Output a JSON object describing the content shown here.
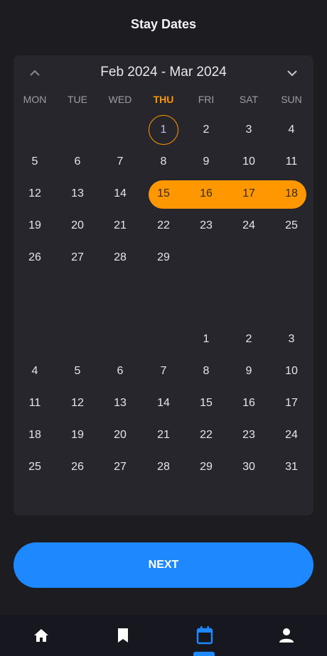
{
  "header": {
    "title": "Stay Dates"
  },
  "calendar": {
    "range_label": "Feb 2024 - Mar 2024",
    "weekdays": [
      "MON",
      "TUE",
      "WED",
      "THU",
      "FRI",
      "SAT",
      "SUN"
    ],
    "today_weekday": "THU",
    "months": [
      {
        "days": [
          [
            "",
            "",
            "",
            "1",
            "2",
            "3",
            "4"
          ],
          [
            "5",
            "6",
            "7",
            "8",
            "9",
            "10",
            "11"
          ],
          [
            "12",
            "13",
            "14",
            "15",
            "16",
            "17",
            "18"
          ],
          [
            "19",
            "20",
            "21",
            "22",
            "23",
            "24",
            "25"
          ],
          [
            "26",
            "27",
            "28",
            "29",
            "",
            "",
            ""
          ]
        ]
      },
      {
        "days": [
          [
            "",
            "",
            "",
            "",
            "1",
            "2",
            "3"
          ],
          [
            "4",
            "5",
            "6",
            "7",
            "8",
            "9",
            "10"
          ],
          [
            "11",
            "12",
            "13",
            "14",
            "15",
            "16",
            "17"
          ],
          [
            "18",
            "19",
            "20",
            "21",
            "22",
            "23",
            "24"
          ],
          [
            "25",
            "26",
            "27",
            "28",
            "29",
            "30",
            "31"
          ]
        ]
      }
    ],
    "today_day": "1",
    "selected_range": [
      "15",
      "16",
      "17",
      "18"
    ],
    "accent_color": "#ff9800"
  },
  "actions": {
    "next_label": "NEXT",
    "next_color": "#1e88ff"
  },
  "bottom_nav": {
    "items": [
      {
        "name": "home",
        "icon": "home-icon"
      },
      {
        "name": "saved",
        "icon": "bookmark-icon"
      },
      {
        "name": "bookings",
        "icon": "calendar-icon",
        "active": true
      },
      {
        "name": "profile",
        "icon": "person-icon"
      }
    ]
  }
}
